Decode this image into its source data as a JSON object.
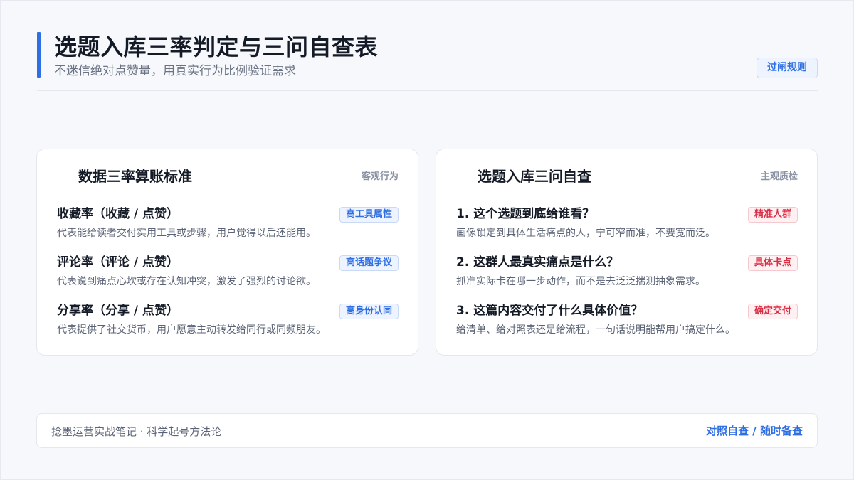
{
  "header": {
    "title": "选题入库三率判定与三问自查表",
    "subtitle": "不迷信绝对点赞量，用真实行为比例验证需求",
    "rule_button": "过闸规则"
  },
  "left_card": {
    "title": "数据三率算账标准",
    "tag": "客观行为",
    "items": [
      {
        "title": "收藏率（收藏 / 点赞）",
        "badge": "高工具属性",
        "desc": "代表能给读者交付实用工具或步骤，用户觉得以后还能用。"
      },
      {
        "title": "评论率（评论 / 点赞）",
        "badge": "高话题争议",
        "desc": "代表说到痛点心坎或存在认知冲突，激发了强烈的讨论欲。"
      },
      {
        "title": "分享率（分享 / 点赞）",
        "badge": "高身份认同",
        "desc": "代表提供了社交货币，用户愿意主动转发给同行或同频朋友。"
      }
    ]
  },
  "right_card": {
    "title": "选题入库三问自查",
    "tag": "主观质检",
    "items": [
      {
        "title": "1. 这个选题到底给谁看？",
        "badge": "精准人群",
        "desc": "画像锁定到具体生活痛点的人，宁可窄而准，不要宽而泛。"
      },
      {
        "title": "2. 这群人最真实痛点是什么？",
        "badge": "具体卡点",
        "desc": "抓准实际卡在哪一步动作，而不是去泛泛揣测抽象需求。"
      },
      {
        "title": "3. 这篇内容交付了什么具体价值？",
        "badge": "确定交付",
        "desc": "给清单、给对照表还是给流程，一句话说明能帮用户搞定什么。"
      }
    ]
  },
  "footer": {
    "left": "捻墨运营实战笔记 · 科学起号方法论",
    "right": "对照自查 / 随时备查"
  },
  "colors": {
    "accent": "#2f6fe4",
    "alert": "#d92e45",
    "background": "#f6f8fb"
  }
}
